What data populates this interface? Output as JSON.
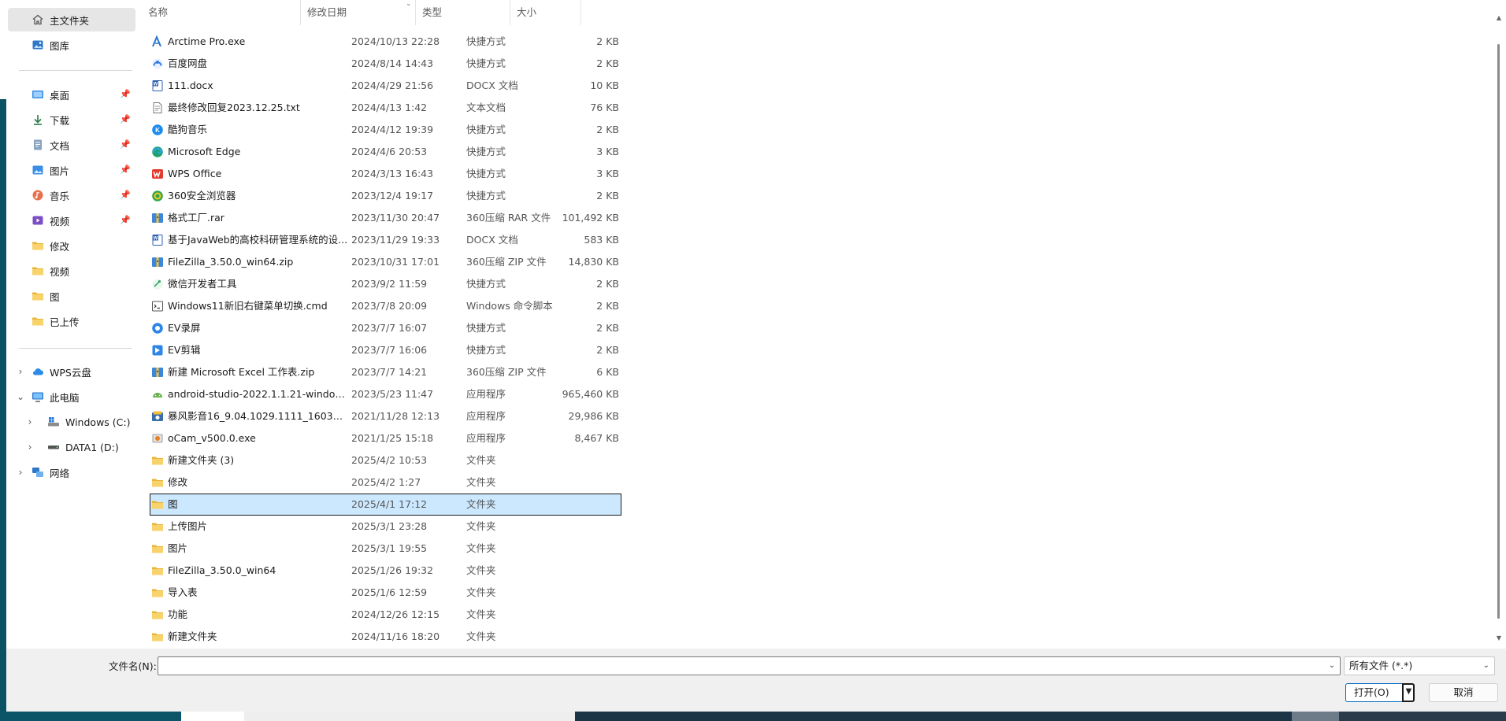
{
  "sidebar": {
    "quick": [
      {
        "label": "主文件夹",
        "icon": "home-icon",
        "selected": true
      },
      {
        "label": "图库",
        "icon": "gallery-icon"
      }
    ],
    "pinned": [
      {
        "label": "桌面",
        "icon": "desktop-icon",
        "pinned": true
      },
      {
        "label": "下载",
        "icon": "download-icon",
        "pinned": true
      },
      {
        "label": "文档",
        "icon": "documents-icon",
        "pinned": true
      },
      {
        "label": "图片",
        "icon": "pictures-icon",
        "pinned": true
      },
      {
        "label": "音乐",
        "icon": "music-icon",
        "pinned": true
      },
      {
        "label": "视频",
        "icon": "videos-icon",
        "pinned": true
      },
      {
        "label": "修改",
        "icon": "folder-icon"
      },
      {
        "label": "视频",
        "icon": "folder-icon"
      },
      {
        "label": "图",
        "icon": "folder-icon"
      },
      {
        "label": "已上传",
        "icon": "folder-icon"
      }
    ],
    "tree": [
      {
        "label": "WPS云盘",
        "icon": "wps-cloud-icon",
        "expanded": false
      },
      {
        "label": "此电脑",
        "icon": "computer-icon",
        "expanded": true
      },
      {
        "label": "Windows (C:)",
        "icon": "drive-c-icon",
        "expanded": false
      },
      {
        "label": "DATA1 (D:)",
        "icon": "drive-d-icon",
        "expanded": false
      },
      {
        "label": "网络",
        "icon": "network-icon",
        "expanded": false
      }
    ]
  },
  "columns": {
    "name": "名称",
    "date": "修改日期",
    "type": "类型",
    "size": "大小"
  },
  "files": [
    {
      "name": "Arctime Pro.exe",
      "date": "2024/10/13 22:28",
      "type": "快捷方式",
      "size": "2 KB",
      "icon": "arctime-icon"
    },
    {
      "name": "百度网盘",
      "date": "2024/8/14 14:43",
      "type": "快捷方式",
      "size": "2 KB",
      "icon": "baidu-netdisk-icon"
    },
    {
      "name": "111.docx",
      "date": "2024/4/29 21:56",
      "type": "DOCX 文档",
      "size": "10 KB",
      "icon": "word-doc-icon"
    },
    {
      "name": "最终修改回复2023.12.25.txt",
      "date": "2024/4/13 1:42",
      "type": "文本文档",
      "size": "76 KB",
      "icon": "text-file-icon"
    },
    {
      "name": "酷狗音乐",
      "date": "2024/4/12 19:39",
      "type": "快捷方式",
      "size": "2 KB",
      "icon": "kugou-icon"
    },
    {
      "name": "Microsoft Edge",
      "date": "2024/4/6 20:53",
      "type": "快捷方式",
      "size": "3 KB",
      "icon": "edge-icon"
    },
    {
      "name": "WPS Office",
      "date": "2024/3/13 16:43",
      "type": "快捷方式",
      "size": "3 KB",
      "icon": "wps-icon"
    },
    {
      "name": "360安全浏览器",
      "date": "2023/12/4 19:17",
      "type": "快捷方式",
      "size": "2 KB",
      "icon": "360-browser-icon"
    },
    {
      "name": "格式工厂.rar",
      "date": "2023/11/30 20:47",
      "type": "360压缩 RAR 文件",
      "size": "101,492 KB",
      "icon": "archive-icon"
    },
    {
      "name": "基于JavaWeb的高校科研管理系统的设...",
      "date": "2023/11/29 19:33",
      "type": "DOCX 文档",
      "size": "583 KB",
      "icon": "word-doc-icon"
    },
    {
      "name": "FileZilla_3.50.0_win64.zip",
      "date": "2023/10/31 17:01",
      "type": "360压缩 ZIP 文件",
      "size": "14,830 KB",
      "icon": "archive-icon"
    },
    {
      "name": "微信开发者工具",
      "date": "2023/9/2 11:59",
      "type": "快捷方式",
      "size": "2 KB",
      "icon": "wechat-devtools-icon"
    },
    {
      "name": "Windows11新旧右键菜单切换.cmd",
      "date": "2023/7/8 20:09",
      "type": "Windows 命令脚本",
      "size": "2 KB",
      "icon": "cmd-script-icon"
    },
    {
      "name": "EV录屏",
      "date": "2023/7/7 16:07",
      "type": "快捷方式",
      "size": "2 KB",
      "icon": "ev-record-icon"
    },
    {
      "name": "EV剪辑",
      "date": "2023/7/7 16:06",
      "type": "快捷方式",
      "size": "2 KB",
      "icon": "ev-edit-icon"
    },
    {
      "name": "新建 Microsoft Excel 工作表.zip",
      "date": "2023/7/7 14:21",
      "type": "360压缩 ZIP 文件",
      "size": "6 KB",
      "icon": "archive-icon"
    },
    {
      "name": "android-studio-2022.1.1.21-windows....",
      "date": "2023/5/23 11:47",
      "type": "应用程序",
      "size": "965,460 KB",
      "icon": "android-studio-icon"
    },
    {
      "name": "暴风影音16_9.04.1029.1111_16039416...",
      "date": "2021/11/28 12:13",
      "type": "应用程序",
      "size": "29,986 KB",
      "icon": "installer-icon"
    },
    {
      "name": "oCam_v500.0.exe",
      "date": "2021/1/25 15:18",
      "type": "应用程序",
      "size": "8,467 KB",
      "icon": "ocam-icon"
    },
    {
      "name": "新建文件夹 (3)",
      "date": "2025/4/2 10:53",
      "type": "文件夹",
      "size": "",
      "icon": "folder-icon"
    },
    {
      "name": "修改",
      "date": "2025/4/2 1:27",
      "type": "文件夹",
      "size": "",
      "icon": "folder-icon"
    },
    {
      "name": "图",
      "date": "2025/4/1 17:12",
      "type": "文件夹",
      "size": "",
      "icon": "folder-icon",
      "selected": true
    },
    {
      "name": "上传图片",
      "date": "2025/3/1 23:28",
      "type": "文件夹",
      "size": "",
      "icon": "folder-icon"
    },
    {
      "name": "图片",
      "date": "2025/3/1 19:55",
      "type": "文件夹",
      "size": "",
      "icon": "folder-icon"
    },
    {
      "name": "FileZilla_3.50.0_win64",
      "date": "2025/1/26 19:32",
      "type": "文件夹",
      "size": "",
      "icon": "folder-icon"
    },
    {
      "name": "导入表",
      "date": "2025/1/6 12:59",
      "type": "文件夹",
      "size": "",
      "icon": "folder-icon"
    },
    {
      "name": "功能",
      "date": "2024/12/26 12:15",
      "type": "文件夹",
      "size": "",
      "icon": "folder-icon"
    },
    {
      "name": "新建文件夹",
      "date": "2024/11/16 18:20",
      "type": "文件夹",
      "size": "",
      "icon": "folder-icon"
    }
  ],
  "footer": {
    "filename_label": "文件名(N):",
    "filename_value": "",
    "filter_value": "所有文件 (*.*)",
    "open_label": "打开(O)",
    "cancel_label": "取消"
  },
  "colors": {
    "selection": "#cce8ff",
    "folder": "#f4c84b",
    "accent": "#0067c0"
  }
}
